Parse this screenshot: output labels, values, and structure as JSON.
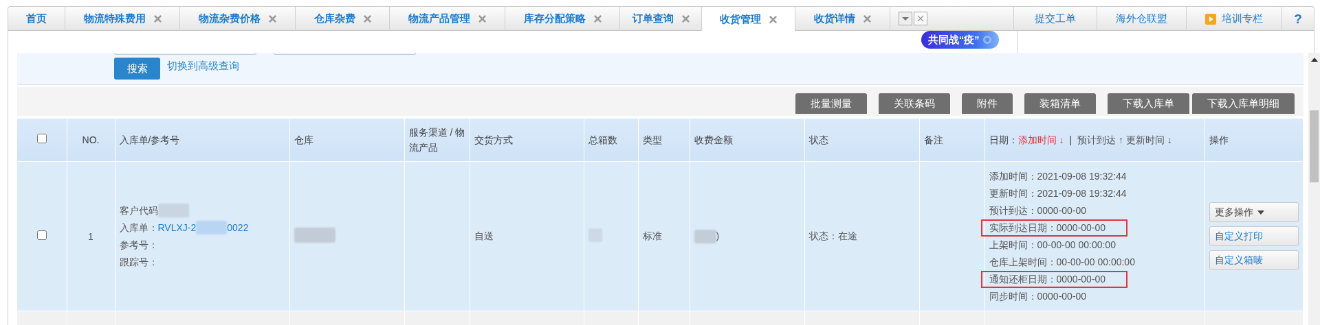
{
  "tabs": [
    {
      "label": "首页",
      "closable": false,
      "selected": false
    },
    {
      "label": "物流特殊费用",
      "closable": true,
      "selected": false
    },
    {
      "label": "物流杂费价格",
      "closable": true,
      "selected": false
    },
    {
      "label": "仓库杂费",
      "closable": true,
      "selected": false
    },
    {
      "label": "物流产品管理",
      "closable": true,
      "selected": false
    },
    {
      "label": "库存分配策略",
      "closable": true,
      "selected": false
    },
    {
      "label": "订单查询",
      "closable": true,
      "selected": false
    },
    {
      "label": "收货管理",
      "closable": true,
      "selected": true
    },
    {
      "label": "收货详情",
      "closable": true,
      "selected": false
    }
  ],
  "top_links": [
    {
      "label": "提交工单",
      "kind": "link"
    },
    {
      "label": "海外仓联盟",
      "kind": "link"
    },
    {
      "label": "培训专栏",
      "kind": "video"
    },
    {
      "label": "?",
      "kind": "help"
    }
  ],
  "badge": "共同战“疫”",
  "search": {
    "button": "搜索",
    "advanced_link": "切换到高级查询"
  },
  "toolbar": [
    "批量测量",
    "关联条码",
    "附件",
    "装箱清单",
    "下载入库单",
    "下载入库单明细"
  ],
  "table": {
    "select_all": {
      "checked": false
    },
    "columns": [
      "NO.",
      "入库单/参考号",
      "仓库",
      "服务渠道 / 物流产品",
      "交货方式",
      "总箱数",
      "类型",
      "收费金额",
      "状态",
      "备注"
    ],
    "date_column": {
      "label": "日期：",
      "separator": "|",
      "sorts": [
        {
          "label": "添加时间 ↓",
          "active": true
        },
        {
          "label": "预计到达 ↑",
          "active": false
        },
        {
          "label": "更新时间 ↓",
          "active": false
        }
      ]
    },
    "action_column": "操作",
    "rows": [
      {
        "checked": false,
        "no": "1",
        "order_lines": [
          {
            "label": "客户代码",
            "redacted": true
          },
          {
            "label": "入库单：",
            "value": "RVLXJ-2",
            "value_end": "0022",
            "redacted": true
          },
          {
            "label": "参考号：",
            "redacted": false
          },
          {
            "label": "跟踪号：",
            "redacted": false
          }
        ],
        "warehouse_redacted": true,
        "delivery": "自送",
        "boxes_redacted": true,
        "type": "标准",
        "fee": ")",
        "status": "状态：在途",
        "dates": [
          {
            "text": "添加时间：2021-09-08 19:32:44",
            "highlighted": false
          },
          {
            "text": "更新时间：2021-09-08 19:32:44",
            "highlighted": false
          },
          {
            "text": "预计到达：0000-00-00",
            "highlighted": false
          },
          {
            "text": "实际到达日期：0000-00-00",
            "highlighted": true
          },
          {
            "text": "上架时间：00-00-00 00:00:00",
            "highlighted": false
          },
          {
            "text": "仓库上架时间：00-00-00 00:00:00",
            "highlighted": false
          },
          {
            "text": "通知还柜日期：0000-00-00",
            "highlighted": true
          },
          {
            "text": "同步时间：0000-00-00",
            "highlighted": false
          }
        ],
        "actions": [
          {
            "label": "更多操作",
            "kind": "dropdown"
          },
          {
            "label": "自定义打印",
            "kind": "link"
          },
          {
            "label": "自定义箱唛",
            "kind": "link"
          }
        ]
      }
    ]
  }
}
